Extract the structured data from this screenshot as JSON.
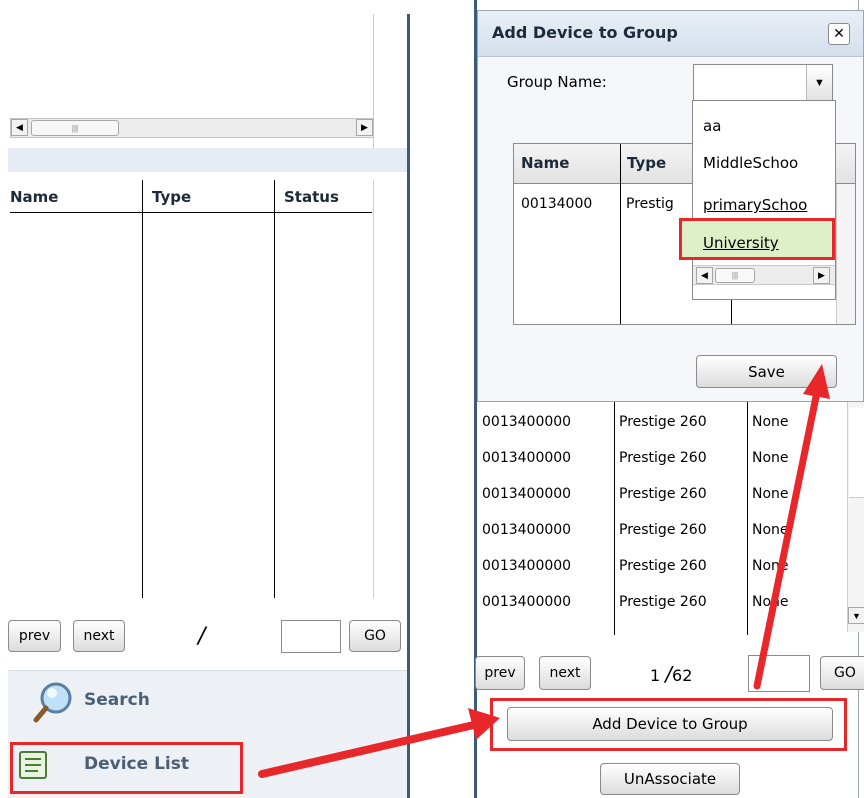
{
  "left_panel": {
    "columns": [
      "Name",
      "Type",
      "Status"
    ],
    "pager": {
      "prev_label": "prev",
      "next_label": "next",
      "page_text": "/",
      "go_label": "GO"
    },
    "nav": {
      "search_label": "Search",
      "device_list_label": "Device List"
    }
  },
  "dialog": {
    "title": "Add Device to Group",
    "group_name_label": "Group Name:",
    "group_select_value": "",
    "dropdown_options": [
      "aa",
      "MiddleSchoo",
      "primarySchoo",
      "University"
    ],
    "inner_table": {
      "columns": [
        "Name",
        "Type"
      ],
      "rows": [
        {
          "name": "00134000",
          "type": "Prestig"
        }
      ]
    },
    "save_label": "Save"
  },
  "right_panel": {
    "rows": [
      {
        "name": "0013400000",
        "type": "Prestige 260",
        "status": "None"
      },
      {
        "name": "0013400000",
        "type": "Prestige 260",
        "status": "None"
      },
      {
        "name": "0013400000",
        "type": "Prestige 260",
        "status": "None"
      },
      {
        "name": "0013400000",
        "type": "Prestige 260",
        "status": "None"
      },
      {
        "name": "0013400000",
        "type": "Prestige 260",
        "status": "None"
      },
      {
        "name": "0013400000",
        "type": "Prestige 260",
        "status": "None"
      }
    ],
    "pager": {
      "prev_label": "prev",
      "next_label": "next",
      "current_page": "1",
      "page_sep": "/",
      "total_pages": "62",
      "go_label": "GO"
    },
    "add_device_label": "Add Device to Group",
    "unassociate_label": "UnAssociate"
  },
  "colors": {
    "highlight": "#e8272a",
    "selected_option_bg": "#dff0c8",
    "nav_text": "#4a6076",
    "panel_band": "#e6ecf4"
  }
}
